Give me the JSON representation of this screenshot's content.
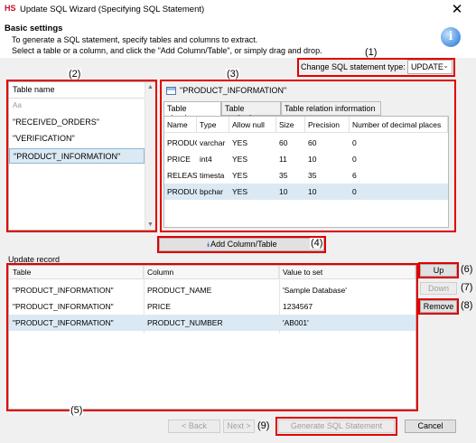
{
  "window": {
    "logo": "HS",
    "title": "Update SQL Wizard (Specifying SQL Statement)",
    "close": "✕"
  },
  "header": {
    "heading": "Basic settings",
    "desc_line1": "To generate a SQL statement, specify tables and columns to extract.",
    "desc_line2": "Select a table or a column, and click the \"Add Column/Table\", or simply drag and drop.",
    "info_glyph": "i"
  },
  "change_type": {
    "label": "Change SQL statement type:",
    "value": "UPDATE"
  },
  "table_list": {
    "header": "Table name",
    "filter_placeholder": "Aa",
    "items": [
      "\"RECEIVED_ORDERS\"",
      "\"VERIFICATION\"",
      "\"PRODUCT_INFORMATION\""
    ],
    "selected_index": 2
  },
  "table_detail": {
    "title": "\"PRODUCT_INFORMATION\"",
    "tabs": [
      "Table structure",
      "Table contents",
      "Table relation information"
    ],
    "active_tab": 0,
    "columns": [
      "Name",
      "Type",
      "Allow null",
      "Size",
      "Precision",
      "Number of decimal places"
    ],
    "rows": [
      [
        "PRODUC",
        "varchar",
        "YES",
        "60",
        "60",
        "0"
      ],
      [
        "PRICE",
        "int4",
        "YES",
        "11",
        "10",
        "0"
      ],
      [
        "RELEASE",
        "timesta",
        "YES",
        "35",
        "35",
        "6"
      ],
      [
        "PRODUC",
        "bpchar",
        "YES",
        "10",
        "10",
        "0"
      ]
    ],
    "selected_row": 3
  },
  "add_button": {
    "label": "Add Column/Table",
    "glyph": "⯯"
  },
  "update_record": {
    "label": "Update record",
    "columns": [
      "Table",
      "Column",
      "Value to set"
    ],
    "rows": [
      [
        "\"PRODUCT_INFORMATION\"",
        "PRODUCT_NAME",
        "'Sample Database'"
      ],
      [
        "\"PRODUCT_INFORMATION\"",
        "PRICE",
        "1234567"
      ],
      [
        "\"PRODUCT_INFORMATION\"",
        "PRODUCT_NUMBER",
        "'AB001'"
      ]
    ],
    "selected_row": 2
  },
  "side_buttons": {
    "up": "Up",
    "down": "Down",
    "remove": "Remove"
  },
  "bottom_buttons": {
    "back": "< Back",
    "next": "Next >",
    "generate": "Generate SQL Statement",
    "cancel": "Cancel"
  },
  "callouts": [
    "(1)",
    "(2)",
    "(3)",
    "(4)",
    "(5)",
    "(6)",
    "(7)",
    "(8)",
    "(9)"
  ],
  "colors": {
    "callout_border": "#e00000",
    "selection": "#dbe9f4",
    "accent_icon": "#1f6fd1"
  }
}
